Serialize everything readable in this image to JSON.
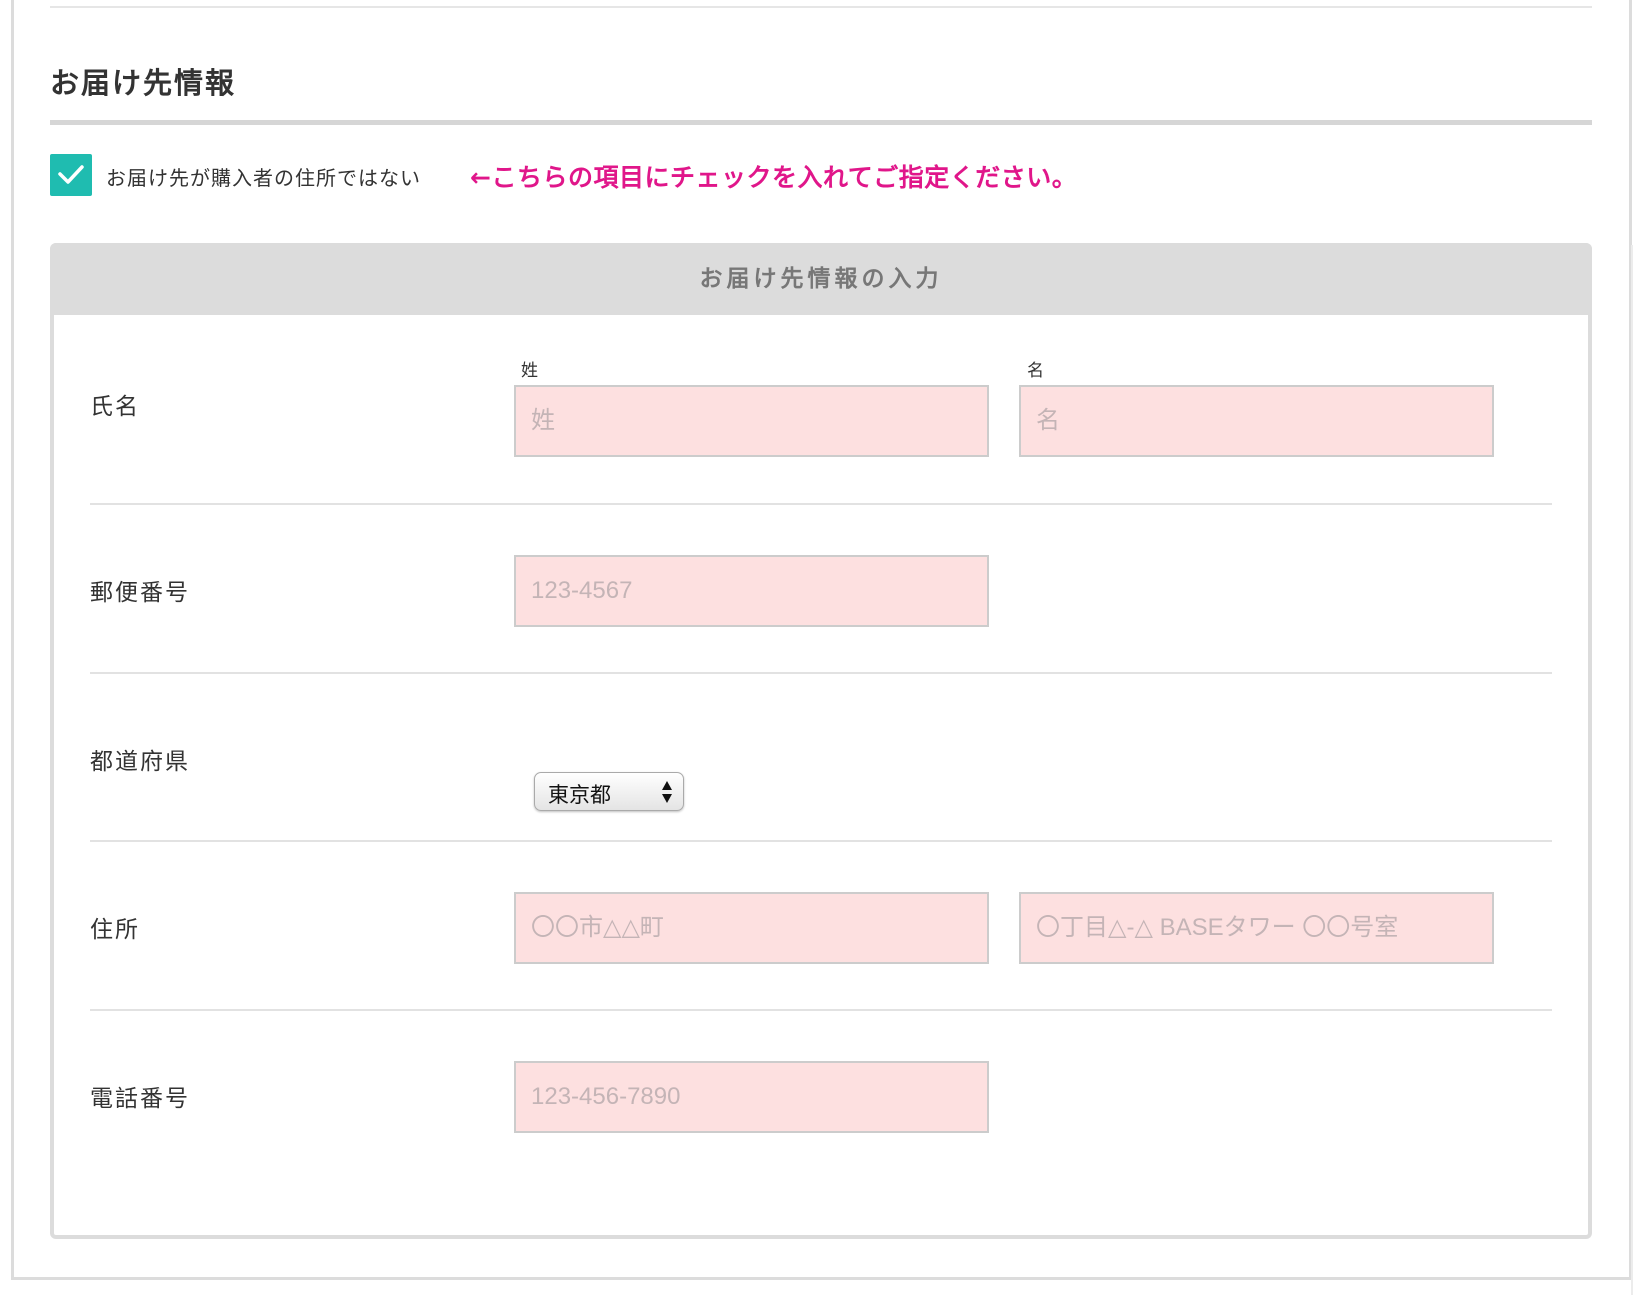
{
  "section": {
    "title": "お届け先情報"
  },
  "checkbox": {
    "checked": true,
    "label": "お届け先が購入者の住所ではない",
    "note": "←こちらの項目にチェックを入れてご指定ください。"
  },
  "panel": {
    "header": "お届け先情報の入力"
  },
  "rows": {
    "name": {
      "label": "氏名",
      "sub_last": "姓",
      "sub_first": "名",
      "placeholder_last": "姓",
      "placeholder_first": "名"
    },
    "postal": {
      "label": "郵便番号",
      "placeholder": "123-4567"
    },
    "prefecture": {
      "label": "都道府県",
      "selected": "東京都"
    },
    "address": {
      "label": "住所",
      "placeholder_1": "〇〇市△△町",
      "placeholder_2": "〇丁目△-△ BASEタワー 〇〇号室"
    },
    "phone": {
      "label": "電話番号",
      "placeholder": "123-456-7890"
    }
  },
  "colors": {
    "accent": "#1fbcb0",
    "note": "#e0168a",
    "field_bg": "#fde0e0",
    "header_bg": "#dcdcdc"
  }
}
